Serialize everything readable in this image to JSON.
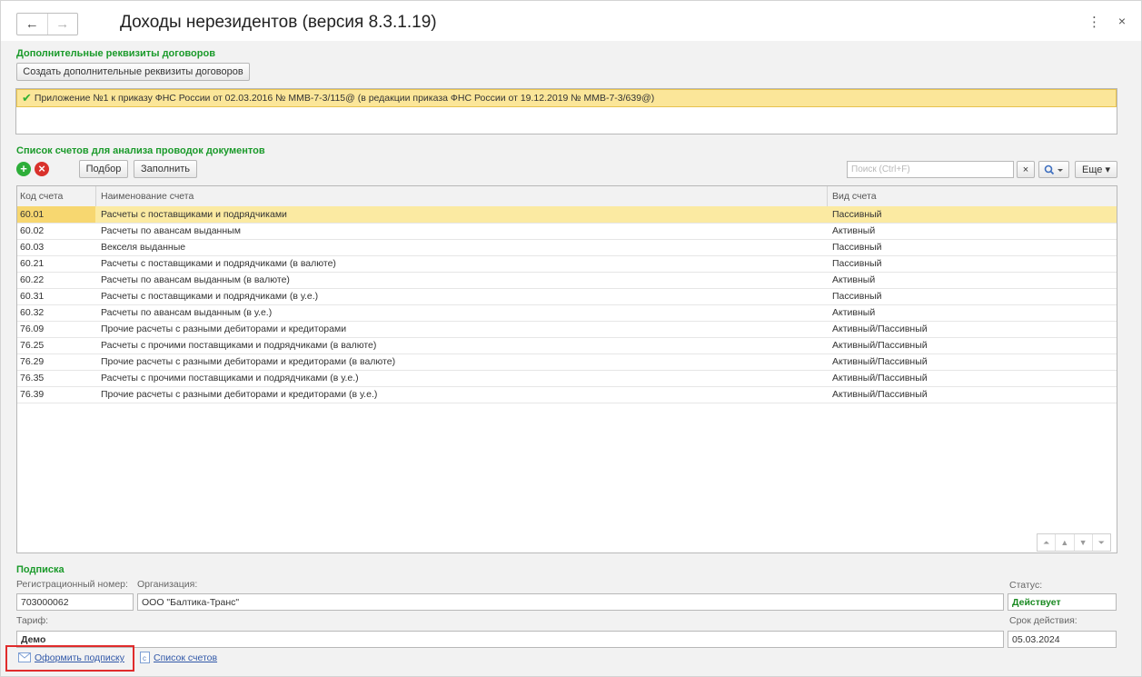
{
  "window": {
    "title": "Доходы нерезидентов (версия 8.3.1.19)",
    "menu_icon": "⋮",
    "close_icon": "×",
    "back_icon": "←",
    "forward_icon": "→"
  },
  "contracts": {
    "section_title": "Дополнительные реквизиты договоров",
    "create_button": "Создать дополнительные реквизиты договоров",
    "items": [
      {
        "text": "Приложение №1 к приказу ФНС России от 02.03.2016 № ММВ-7-3/115@ (в редакции приказа ФНС России от 19.12.2019 № ММВ-7-3/639@)",
        "checked": true
      }
    ]
  },
  "accounts": {
    "section_title": "Список счетов для анализа проводок документов",
    "select_button": "Подбор",
    "fill_button": "Заполнить",
    "search_placeholder": "Поиск (Ctrl+F)",
    "more_button": "Еще ▾",
    "columns": [
      "Код счета",
      "Наименование счета",
      "Вид счета"
    ],
    "rows": [
      {
        "code": "60.01",
        "name": "Расчеты с поставщиками и подрядчиками",
        "type": "Пассивный",
        "selected": true
      },
      {
        "code": "60.02",
        "name": "Расчеты по авансам выданным",
        "type": "Активный"
      },
      {
        "code": "60.03",
        "name": "Векселя выданные",
        "type": "Пассивный"
      },
      {
        "code": "60.21",
        "name": "Расчеты с поставщиками и подрядчиками (в валюте)",
        "type": "Пассивный"
      },
      {
        "code": "60.22",
        "name": "Расчеты по авансам выданным (в валюте)",
        "type": "Активный"
      },
      {
        "code": "60.31",
        "name": "Расчеты с поставщиками и подрядчиками (в у.е.)",
        "type": "Пассивный"
      },
      {
        "code": "60.32",
        "name": "Расчеты по авансам выданным (в у.е.)",
        "type": "Активный"
      },
      {
        "code": "76.09",
        "name": "Прочие расчеты с разными дебиторами и кредиторами",
        "type": "Активный/Пассивный"
      },
      {
        "code": "76.25",
        "name": "Расчеты с прочими поставщиками и подрядчиками (в валюте)",
        "type": "Активный/Пассивный"
      },
      {
        "code": "76.29",
        "name": "Прочие расчеты с разными дебиторами и кредиторами (в валюте)",
        "type": "Активный/Пассивный"
      },
      {
        "code": "76.35",
        "name": "Расчеты с прочими поставщиками и подрядчиками (в у.е.)",
        "type": "Активный/Пассивный"
      },
      {
        "code": "76.39",
        "name": "Прочие расчеты с разными дебиторами и кредиторами (в у.е.)",
        "type": "Активный/Пассивный"
      }
    ]
  },
  "subscription": {
    "section_title": "Подписка",
    "reg_number_label": "Регистрационный номер:",
    "reg_number": "703000062",
    "organization_label": "Организация:",
    "organization": "ООО \"Балтика-Транс\"",
    "status_label": "Статус:",
    "status": "Действует",
    "tariff_label": "Тариф:",
    "tariff": "Демо",
    "validity_label": "Срок действия:",
    "validity": "05.03.2024",
    "subscribe_link": "Оформить подписку",
    "accounts_link": "Список счетов"
  },
  "colors": {
    "accent_green": "#1a9a2a",
    "selected_row": "#fbeaa2",
    "highlight_red": "#e02b2b",
    "link_blue": "#3158a8"
  }
}
